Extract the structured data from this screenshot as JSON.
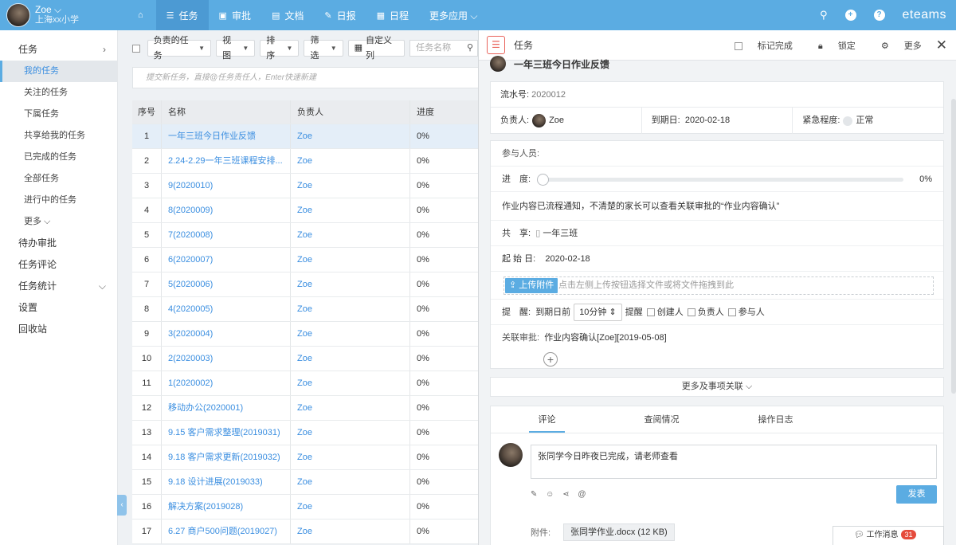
{
  "user": {
    "name": "Zoe ⌵",
    "org": "上海xx小学"
  },
  "nav": [
    {
      "icon": "⌂",
      "label": ""
    },
    {
      "icon": "☰",
      "label": "任务"
    },
    {
      "icon": "▣",
      "label": "审批"
    },
    {
      "icon": "▤",
      "label": "文档"
    },
    {
      "icon": "✎",
      "label": "日报"
    },
    {
      "icon": "▦",
      "label": "日程"
    },
    {
      "icon": "",
      "label": "更多应用 ⌵"
    }
  ],
  "top_right": {
    "brand": "eteams"
  },
  "sidebar": [
    {
      "label": "任务",
      "type": "top",
      "arrow": "›"
    },
    {
      "label": "我的任务",
      "type": "sub",
      "active": true
    },
    {
      "label": "关注的任务",
      "type": "sub"
    },
    {
      "label": "下属任务",
      "type": "sub"
    },
    {
      "label": "共享给我的任务",
      "type": "sub"
    },
    {
      "label": "已完成的任务",
      "type": "sub"
    },
    {
      "label": "全部任务",
      "type": "sub"
    },
    {
      "label": "进行中的任务",
      "type": "sub"
    },
    {
      "label": "更多 ⌵",
      "type": "sub"
    },
    {
      "label": "待办审批",
      "type": "top"
    },
    {
      "label": "任务评论",
      "type": "top"
    },
    {
      "label": "任务统计",
      "type": "top",
      "arrow": "⌵"
    },
    {
      "label": "设置",
      "type": "top"
    },
    {
      "label": "回收站",
      "type": "top"
    }
  ],
  "toolbar": {
    "filter1": "负责的任务",
    "view": "视图",
    "sort": "排序",
    "filter": "筛选",
    "custom": "自定义列",
    "search_placeholder": "任务名称"
  },
  "new_task_placeholder": "提交新任务，直接@任务责任人，Enter快速新建",
  "table": {
    "headers": [
      "序号",
      "名称",
      "负责人",
      "进度"
    ],
    "rows": [
      [
        "1",
        "一年三班今日作业反馈",
        "Zoe",
        "0%"
      ],
      [
        "2",
        "2.24-2.29一年三班课程安排...",
        "Zoe",
        "0%"
      ],
      [
        "3",
        "9(2020010)",
        "Zoe",
        "0%"
      ],
      [
        "4",
        "8(2020009)",
        "Zoe",
        "0%"
      ],
      [
        "5",
        "7(2020008)",
        "Zoe",
        "0%"
      ],
      [
        "6",
        "6(2020007)",
        "Zoe",
        "0%"
      ],
      [
        "7",
        "5(2020006)",
        "Zoe",
        "0%"
      ],
      [
        "8",
        "4(2020005)",
        "Zoe",
        "0%"
      ],
      [
        "9",
        "3(2020004)",
        "Zoe",
        "0%"
      ],
      [
        "10",
        "2(2020003)",
        "Zoe",
        "0%"
      ],
      [
        "11",
        "1(2020002)",
        "Zoe",
        "0%"
      ],
      [
        "12",
        "移动办公(2020001)",
        "Zoe",
        "0%"
      ],
      [
        "13",
        "9.15 客户需求整理(2019031)",
        "Zoe",
        "0%"
      ],
      [
        "14",
        "9.18 客户需求更新(2019032)",
        "Zoe",
        "0%"
      ],
      [
        "15",
        "9.18 设计进展(2019033)",
        "Zoe",
        "0%"
      ],
      [
        "16",
        "解决方案(2019028)",
        "Zoe",
        "0%"
      ],
      [
        "17",
        "6.27 商户500问题(2019027)",
        "Zoe",
        "0%"
      ]
    ]
  },
  "panel": {
    "title": "任务",
    "mark_done": "标记完成",
    "lock": "锁定",
    "more": "更多",
    "close": "✕",
    "task_title": "一年三班今日作业反馈",
    "serial_label": "流水号:",
    "serial": "2020012",
    "owner_label": "负责人:",
    "owner": "Zoe",
    "due_label": "到期日:",
    "due": "2020-02-18",
    "urgency_label": "紧急程度:",
    "urgency": "正常",
    "participants_label": "参与人员:",
    "progress_label": "进　度:",
    "progress_text": "0%",
    "progress_value": 0,
    "desc": "作业内容已流程通知，不清楚的家长可以查看关联审批的“作业内容确认”",
    "share_label": "共　享:",
    "share": "一年三班",
    "start_label": "起 始 日:",
    "start": "2020-02-18",
    "upload_btn": "上传附件",
    "upload_hint": "点击左侧上传按钮选择文件或将文件拖拽到此",
    "remind_label": "提　醒:",
    "remind_before": "到期日前",
    "remind_mins": "10分钟 ⇕",
    "remind_word": "提醒",
    "creator": "创建人",
    "owner_cb": "负责人",
    "participant": "参与人",
    "related_label": "关联审批:",
    "related": "作业内容确认[Zoe][2019-05-08]",
    "more_links": "更多及事项关联 ⌵",
    "tabs": [
      "评论",
      "查阅情况",
      "操作日志"
    ],
    "comment": "张同学今日昨夜已完成，请老师查看",
    "send": "发表",
    "attach_label": "附件:",
    "attach_file": "张同学作业.docx (12 KB)"
  },
  "message": {
    "label": "工作消息",
    "count": "31"
  }
}
